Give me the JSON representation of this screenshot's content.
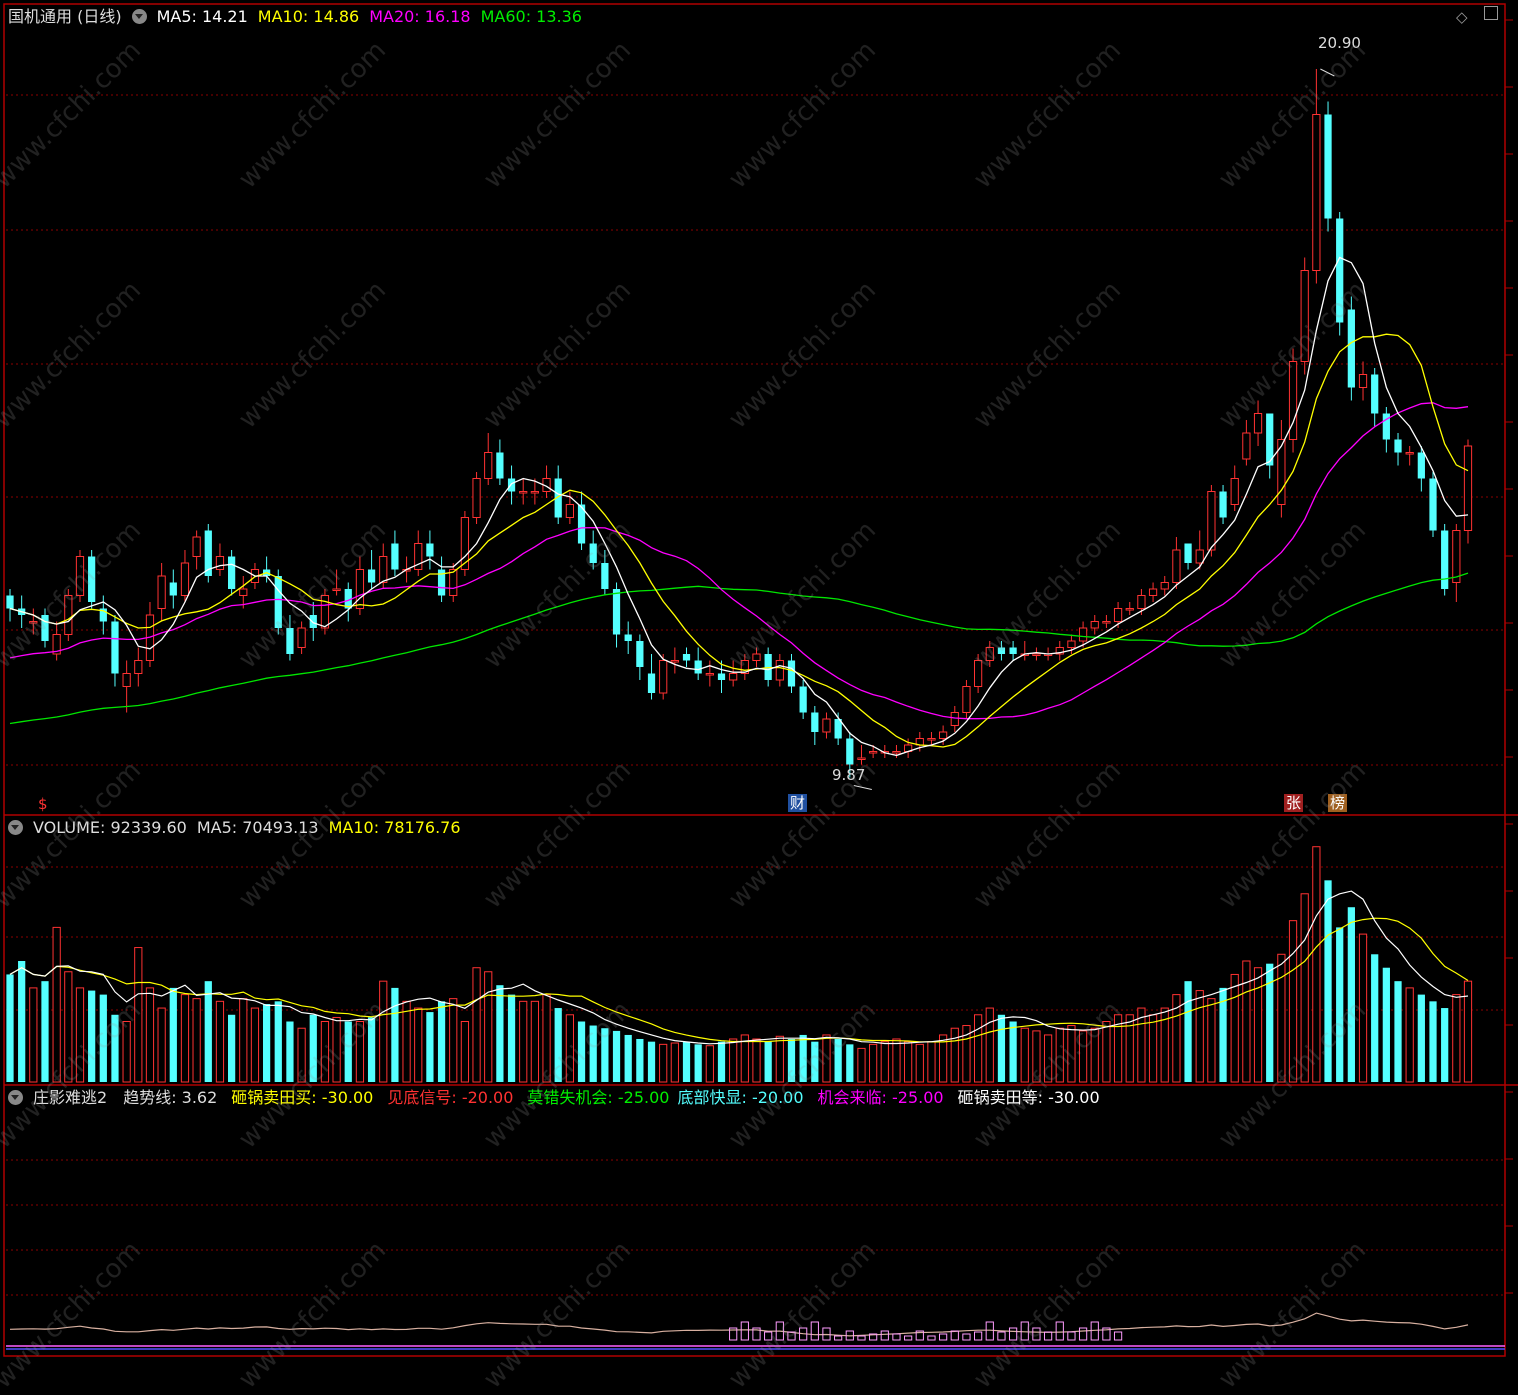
{
  "header": {
    "stock": "国机通用 (日线)",
    "ma5": "MA5: 14.21",
    "ma10": "MA10: 14.86",
    "ma20": "MA20: 16.18",
    "ma60": "MA60: 13.36"
  },
  "volume_header": {
    "vol": "VOLUME: 92339.60",
    "ma5": "MA5: 70493.13",
    "ma10": "MA10: 78176.76"
  },
  "indicator_header": {
    "name": "庄影难逃2",
    "trend": "趋势线: 3.62",
    "s1": "砸锅卖田买: -30.00",
    "s2": "见底信号: -20.00",
    "s3": "莫错失机会: -25.00",
    "s4": "底部快显: -20.00",
    "s5": "机会来临: -25.00",
    "s6": "砸锅卖田等: -30.00"
  },
  "annotations": {
    "high": "20.90",
    "low": "9.87",
    "tag_s": "$",
    "tag_cai": "财",
    "tag_zhang": "张",
    "tag_bang": "榜"
  },
  "watermark": "www.cfchi.com",
  "colors": {
    "up": "#ff3232",
    "down": "#54ffff",
    "ma5": "#ffffff",
    "ma10": "#ffff00",
    "ma20": "#ff00ff",
    "ma60": "#00e600",
    "grid": "#8b0000",
    "border": "#b00000"
  },
  "chart_data": [
    {
      "type": "candlestick",
      "series": "price",
      "open": [
        12.8,
        12.6,
        12.4,
        12.5,
        11.9,
        12.2,
        12.8,
        13.4,
        12.6,
        12.4,
        11.4,
        11.6,
        11.8,
        12.6,
        13.0,
        12.8,
        13.4,
        13.8,
        13.2,
        13.4,
        12.8,
        13.0,
        13.2,
        13.1,
        12.3,
        12.0,
        12.5,
        12.3,
        12.9,
        12.9,
        12.6,
        13.2,
        13.0,
        13.6,
        13.2,
        13.2,
        13.6,
        13.2,
        12.8,
        13.2,
        14.0,
        14.6,
        15.0,
        14.6,
        14.4,
        14.4,
        14.4,
        14.6,
        14.0,
        14.2,
        13.6,
        13.3,
        12.9,
        12.2,
        12.1,
        11.6,
        11.3,
        11.8,
        11.9,
        11.8,
        11.6,
        11.6,
        11.5,
        11.6,
        11.8,
        11.9,
        11.5,
        11.8,
        11.4,
        11.0,
        10.7,
        10.9,
        10.6,
        10.3,
        10.4,
        10.4,
        10.4,
        10.4,
        10.5,
        10.6,
        10.6,
        10.8,
        11.0,
        11.4,
        11.8,
        12.0,
        12.0,
        11.9,
        11.9,
        11.9,
        11.9,
        12.0,
        12.1,
        12.3,
        12.4,
        12.4,
        12.6,
        12.6,
        12.8,
        12.9,
        13.0,
        13.6,
        13.3,
        13.5,
        14.4,
        14.2,
        14.9,
        15.3,
        15.6,
        14.2,
        15.2,
        16.4,
        17.8,
        20.2,
        18.6,
        17.2,
        16.0,
        16.2,
        15.6,
        15.2,
        15.0,
        15.0,
        14.6,
        13.8,
        13.0,
        13.8
      ],
      "close": [
        12.6,
        12.5,
        12.4,
        12.1,
        12.2,
        12.8,
        13.4,
        12.7,
        12.4,
        11.6,
        11.6,
        11.8,
        12.5,
        13.1,
        12.8,
        13.3,
        13.7,
        13.1,
        13.4,
        12.9,
        12.9,
        13.2,
        13.1,
        12.3,
        11.9,
        12.3,
        12.3,
        12.8,
        12.9,
        12.6,
        13.2,
        13.0,
        13.4,
        13.2,
        13.2,
        13.6,
        13.4,
        12.8,
        13.2,
        14.0,
        14.6,
        15.0,
        14.6,
        14.4,
        14.4,
        14.4,
        14.6,
        14.0,
        14.2,
        13.6,
        13.3,
        12.9,
        12.2,
        12.1,
        11.7,
        11.3,
        11.8,
        11.8,
        11.8,
        11.6,
        11.6,
        11.5,
        11.6,
        11.8,
        11.9,
        11.5,
        11.8,
        11.4,
        11.0,
        10.7,
        10.9,
        10.6,
        10.2,
        10.3,
        10.4,
        10.4,
        10.4,
        10.5,
        10.6,
        10.6,
        10.7,
        11.0,
        11.4,
        11.8,
        12.0,
        11.9,
        11.9,
        11.9,
        11.9,
        11.9,
        12.0,
        12.1,
        12.3,
        12.4,
        12.4,
        12.6,
        12.6,
        12.8,
        12.9,
        13.0,
        13.5,
        13.3,
        13.5,
        14.4,
        14.0,
        14.6,
        15.3,
        15.6,
        14.8,
        15.2,
        16.4,
        17.8,
        20.2,
        18.6,
        17.0,
        16.0,
        16.2,
        15.6,
        15.2,
        15.0,
        15.0,
        14.6,
        13.8,
        12.9,
        13.8,
        15.1
      ],
      "high": [
        12.9,
        12.8,
        12.6,
        12.6,
        12.4,
        12.9,
        13.5,
        13.5,
        12.8,
        12.5,
        11.8,
        12.0,
        12.7,
        13.3,
        13.2,
        13.5,
        13.8,
        13.9,
        13.6,
        13.5,
        13.1,
        13.3,
        13.4,
        13.2,
        12.5,
        12.4,
        12.7,
        12.9,
        13.2,
        13.0,
        13.4,
        13.5,
        13.6,
        13.8,
        13.4,
        13.8,
        13.8,
        13.4,
        13.3,
        14.1,
        14.7,
        15.3,
        15.2,
        14.8,
        14.6,
        14.6,
        14.8,
        14.8,
        14.4,
        14.4,
        13.8,
        13.5,
        13.0,
        12.4,
        12.2,
        11.9,
        11.9,
        12.0,
        12.0,
        12.0,
        11.8,
        11.8,
        11.8,
        11.9,
        12.0,
        12.0,
        11.9,
        11.9,
        11.5,
        11.1,
        11.0,
        11.0,
        10.7,
        10.5,
        10.5,
        10.5,
        10.5,
        10.6,
        10.7,
        10.7,
        10.8,
        11.1,
        11.5,
        11.9,
        12.1,
        12.1,
        12.1,
        12.1,
        12.0,
        12.0,
        12.1,
        12.2,
        12.4,
        12.5,
        12.5,
        12.7,
        12.7,
        12.9,
        13.0,
        13.1,
        13.7,
        13.6,
        13.8,
        14.5,
        14.5,
        14.8,
        15.5,
        15.8,
        15.6,
        15.5,
        16.6,
        18.0,
        20.9,
        20.4,
        18.7,
        17.4,
        16.4,
        16.3,
        15.7,
        15.3,
        15.1,
        15.1,
        14.7,
        13.9,
        13.9,
        15.2
      ],
      "low": [
        12.4,
        12.3,
        12.2,
        12.0,
        11.8,
        12.1,
        12.7,
        12.6,
        12.2,
        11.4,
        11.0,
        11.4,
        11.7,
        12.4,
        12.6,
        12.7,
        13.2,
        13.0,
        13.1,
        12.8,
        12.6,
        12.9,
        13.0,
        12.2,
        11.8,
        11.9,
        12.1,
        12.2,
        12.8,
        12.4,
        12.5,
        12.9,
        12.9,
        13.1,
        13.0,
        13.1,
        13.2,
        12.7,
        12.7,
        13.1,
        13.9,
        14.5,
        14.5,
        14.2,
        14.2,
        14.2,
        14.3,
        13.9,
        13.9,
        13.5,
        13.2,
        12.8,
        12.0,
        11.9,
        11.5,
        11.2,
        11.2,
        11.6,
        11.7,
        11.5,
        11.4,
        11.3,
        11.4,
        11.5,
        11.7,
        11.4,
        11.4,
        11.3,
        10.9,
        10.5,
        10.6,
        10.5,
        10.0,
        10.2,
        10.3,
        10.3,
        10.3,
        10.3,
        10.4,
        10.5,
        10.5,
        10.7,
        10.9,
        11.3,
        11.7,
        11.8,
        11.8,
        11.8,
        11.8,
        11.8,
        11.8,
        11.9,
        12.0,
        12.2,
        12.3,
        12.3,
        12.5,
        12.5,
        12.7,
        12.8,
        12.9,
        13.2,
        13.2,
        13.4,
        13.9,
        14.1,
        14.8,
        15.1,
        14.6,
        14.0,
        15.0,
        16.2,
        17.6,
        18.4,
        16.8,
        15.8,
        15.8,
        15.4,
        15.0,
        14.8,
        14.8,
        14.4,
        13.7,
        12.8,
        12.7,
        13.6
      ],
      "ylim": [
        9.5,
        21.5
      ]
    },
    {
      "type": "bar",
      "series": "volume",
      "values": [
        8.0,
        9.0,
        7.0,
        7.5,
        11.5,
        8.2,
        7.0,
        6.8,
        6.5,
        5.0,
        4.5,
        10.0,
        7.0,
        5.5,
        7.0,
        6.5,
        6.2,
        7.5,
        6.0,
        5.0,
        6.2,
        5.5,
        5.8,
        6.0,
        4.5,
        4.0,
        5.0,
        4.5,
        4.8,
        4.5,
        4.5,
        4.8,
        7.5,
        7.0,
        6.0,
        5.5,
        5.2,
        6.0,
        6.2,
        4.5,
        8.5,
        8.2,
        7.2,
        6.5,
        6.0,
        6.0,
        6.5,
        5.5,
        5.0,
        4.5,
        4.2,
        4.0,
        3.8,
        3.5,
        3.2,
        3.0,
        2.8,
        2.9,
        3.0,
        2.8,
        2.7,
        3.0,
        3.2,
        3.5,
        3.2,
        3.0,
        3.4,
        3.2,
        3.5,
        3.0,
        3.5,
        3.2,
        2.8,
        2.5,
        2.8,
        3.0,
        3.2,
        3.0,
        2.8,
        3.0,
        3.5,
        4.0,
        4.2,
        5.0,
        5.5,
        5.0,
        4.5,
        4.0,
        3.8,
        3.5,
        4.0,
        4.2,
        3.8,
        4.0,
        4.5,
        5.0,
        5.0,
        5.5,
        5.0,
        5.5,
        6.5,
        7.5,
        6.8,
        6.2,
        7.0,
        8.0,
        9.0,
        8.5,
        8.8,
        9.5,
        12.0,
        14.0,
        17.5,
        15.0,
        11.5,
        13.0,
        11.0,
        9.5,
        8.5,
        7.5,
        7.0,
        6.5,
        6.0,
        5.5,
        6.5,
        7.5
      ],
      "ylim": [
        0,
        18
      ]
    },
    {
      "type": "line",
      "series": "indicator",
      "name": "趋势线",
      "ylim": [
        -40,
        30
      ]
    }
  ]
}
